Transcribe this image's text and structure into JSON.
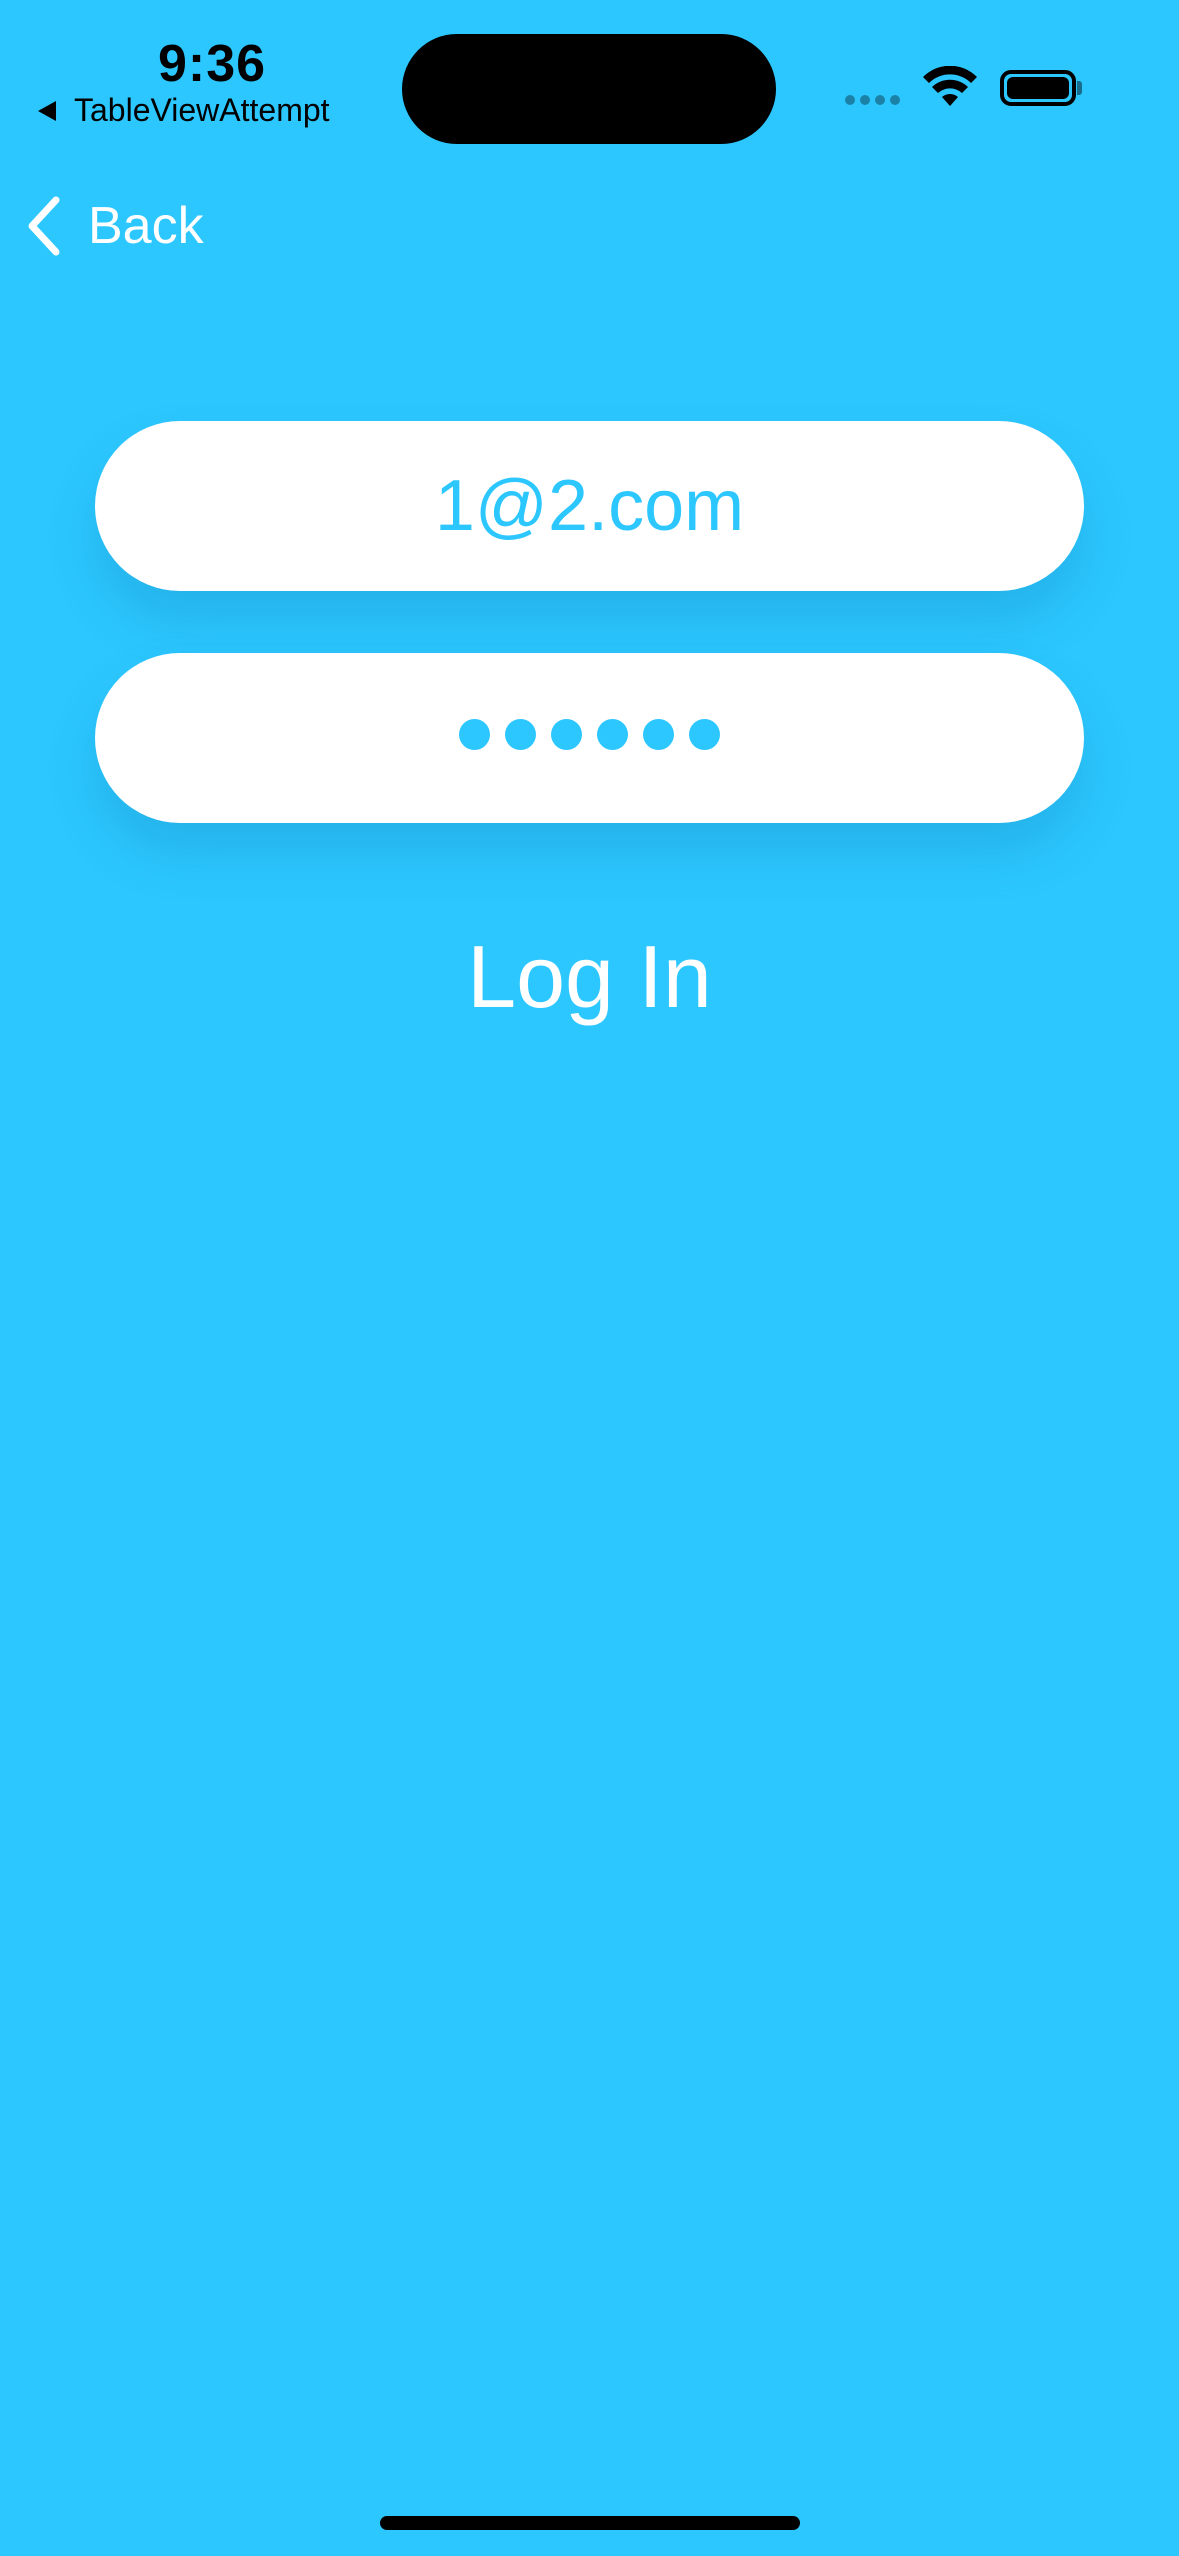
{
  "status_bar": {
    "time": "9:36",
    "back_app_label": "TableViewAttempt"
  },
  "nav": {
    "back_label": "Back"
  },
  "form": {
    "email_value": "1@2.com",
    "password_masked": "●●●●●●",
    "password_length": 6,
    "login_label": "Log In"
  },
  "colors": {
    "background": "#2cc7ff",
    "field": "#ffffff",
    "field_text": "#2cc7ff",
    "label_text": "#ffffff"
  },
  "icons": {
    "back": "chevron-left-icon",
    "back_to_app": "triangle-left-icon",
    "wifi": "wifi-icon",
    "battery": "battery-icon",
    "signal": "cellular-signal-icon"
  }
}
